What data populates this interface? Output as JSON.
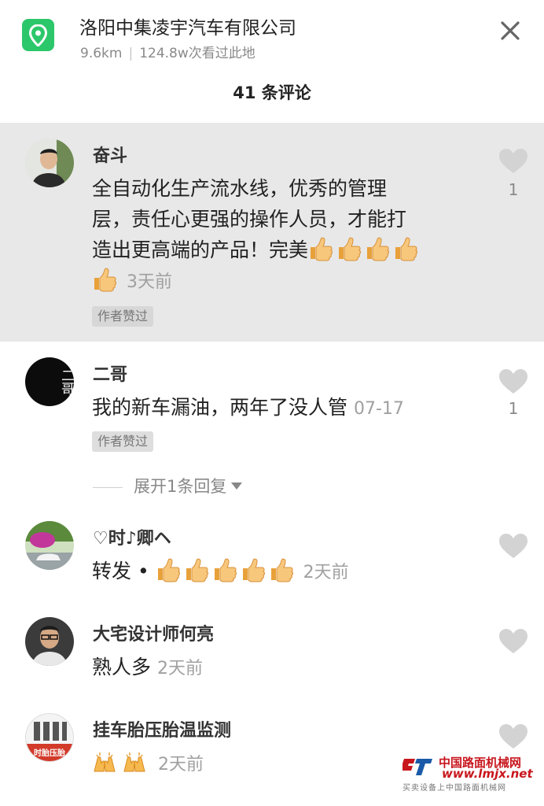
{
  "header": {
    "title": "洛阳中集凌宇汽车有限公司",
    "distance": "9.6km",
    "views": "124.8w次看过此地",
    "location_icon": "location-pin-icon",
    "close_icon": "close-icon"
  },
  "comment_count": "41 条评论",
  "comments": [
    {
      "name": "奋斗",
      "lines": [
        "全自动化生产流水线，优秀的管理",
        "层，责任心更强的操作人员，才能打",
        "造出更高端的产品！完美"
      ],
      "emoji": "thumbs-up",
      "emoji_count": 5,
      "time": "3天前",
      "badge": "作者赞过",
      "likes": "1"
    },
    {
      "name": "二哥",
      "text": "我的新车漏油，两年了没人管",
      "time": "07-17",
      "badge": "作者赞过",
      "likes": "1",
      "avatar_text": "二哥",
      "expand_label": "展开1条回复"
    },
    {
      "name": "♡时♪卿ヘ",
      "text": "转发 •",
      "emoji": "thumbs-up",
      "emoji_count": 5,
      "time": "2天前"
    },
    {
      "name": "大宅设计师何亮",
      "text": "熟人多",
      "time": "2天前"
    },
    {
      "name": "挂车胎压胎温监测",
      "emoji": "raising-hands",
      "emoji_count": 2,
      "time": "2天前",
      "avatar_text": "时胎压胎"
    }
  ],
  "watermark": {
    "name": "中国路面机械网",
    "url": "www.lmjx.net",
    "sub": "买卖设备上中国路面机械网"
  },
  "colors": {
    "accent_green": "#2cc76a",
    "highlight_bg": "#e8e8e8",
    "watermark_red": "#c8161d"
  }
}
